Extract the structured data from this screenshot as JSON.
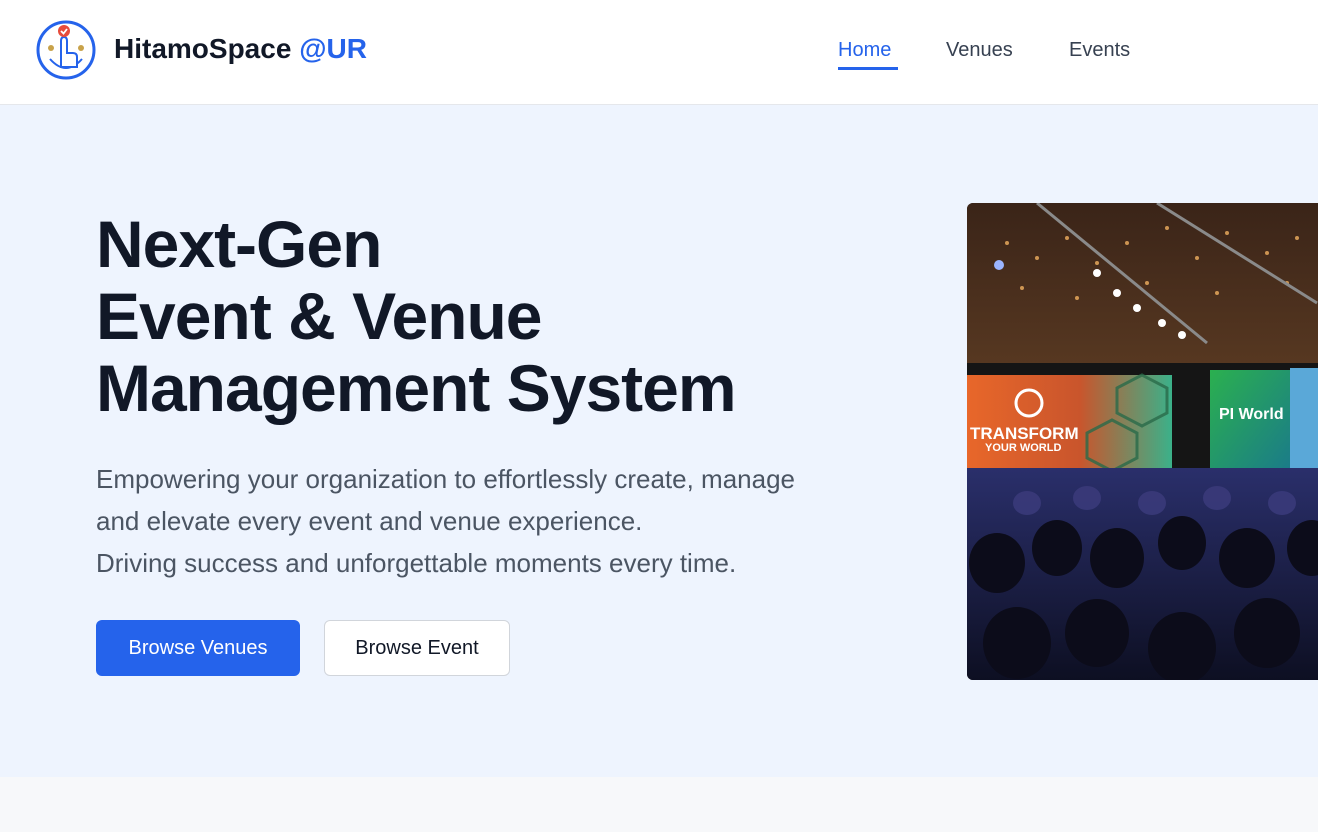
{
  "brand": {
    "name": "HitamoSpace",
    "suffix": "@UR"
  },
  "nav": {
    "items": [
      {
        "label": "Home",
        "active": true
      },
      {
        "label": "Venues",
        "active": false
      },
      {
        "label": "Events",
        "active": false
      }
    ]
  },
  "hero": {
    "title_lines": [
      "Next-Gen",
      "Event & Venue",
      "Management System"
    ],
    "subtitle_lines": [
      "Empowering your organization to effortlessly create, manage",
      "and elevate every event and venue experience.",
      "Driving success and unforgettable moments every time."
    ],
    "primary_button": "Browse Venues",
    "secondary_button": "Browse Event",
    "image": {
      "screen_left_text_1": "TRANSFORM",
      "screen_left_text_2": "YOUR WORLD",
      "screen_right_text": "PI World"
    }
  },
  "colors": {
    "accent": "#2563eb",
    "heading": "#111827",
    "body_text": "#4b5563",
    "hero_bg": "#eef4fe"
  }
}
